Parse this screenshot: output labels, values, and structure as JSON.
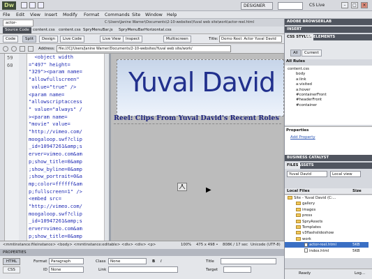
{
  "app": {
    "logo": "Dw",
    "workspace": "DESIGNER",
    "cs_live": "CS Live"
  },
  "menu": [
    "File",
    "Edit",
    "View",
    "Insert",
    "Modify",
    "Format",
    "Commands",
    "Site",
    "Window",
    "Help"
  ],
  "document": {
    "tab": "actor-reel.html",
    "path": "C:\\Users\\Janine Warner\\Documents\\2-10-websites\\Yuval web site\\work\\actor-reel.html",
    "related_files": [
      "Source Code",
      "content.css",
      "content.css",
      "SpryMenuBar.js",
      "SpryMenuBarHorizontal.css"
    ]
  },
  "toolbar": {
    "buttons": [
      "Code",
      "Split",
      "Design",
      "Live Code",
      "Live View",
      "Inspect",
      "Multiscreen"
    ],
    "title_label": "Title:",
    "title_value": "Demo Reel: Actor Yuval David"
  },
  "address": {
    "label": "Address:",
    "value": "file:///C|/Users/Janine Warner/Documents/2-10-websites/Yuval web site/work/"
  },
  "code": {
    "line_numbers": [
      "59",
      "60"
    ],
    "lines": [
      "  <object width",
      "=\"497\" height=",
      "\"329\"><param name=",
      "\"allowfullscreen\"",
      " value=\"true\" />",
      "<param name=",
      "\"allowscriptaccess",
      "\" value=\"always\" /",
      "><param name=",
      "\"movie\" value=",
      "\"http://vimeo.com/",
      "moogaloop.swf?clip",
      "_id=10947261&amp;s",
      "erver=vimeo.com&am",
      "p;show_title=0&amp",
      ";show_byline=0&amp",
      ";show_portrait=0&a",
      "mp;color=ffffff&am",
      "p;fullscreen=1\" />",
      "<embed src=",
      "\"http://vimeo.com/",
      "moogaloop.swf?clip",
      "_id=10947261&amp;s",
      "erver=vimeo.com&am",
      "p;show_title=0&amp"
    ]
  },
  "design": {
    "banner_title": "Yuval David",
    "heading": "Reel: Clips From Yuval David's Recent Roles"
  },
  "status": {
    "tags": "<mmtinstance:fileinstance> <body> <mmtinstance:editable> <div> <div> <p>",
    "zoom": "100%",
    "size": "475 x 498 •",
    "file_info": "808K / 17 sec",
    "encoding": "Unicode (UTF-8)"
  },
  "properties": {
    "header": "PROPERTIES",
    "html_btn": "HTML",
    "css_btn": "CSS",
    "format_label": "Format",
    "format_value": "Paragraph",
    "id_label": "ID",
    "id_value": "None",
    "class_label": "Class",
    "class_value": "None",
    "link_label": "Link",
    "title_label": "Title",
    "target_label": "Target",
    "bold": "B",
    "italic": "I"
  },
  "panels": {
    "adobe_browserlab": "ADOBE BROWSERLAB",
    "insert": "INSERT",
    "css_styles_tab": "CSS STYLES",
    "ap_elements_tab": "AP ELEMENTS",
    "all_btn": "All",
    "current_btn": "Current",
    "all_rules": "All Rules",
    "rules": [
      "content.css",
      "body",
      "a:link",
      "a:visited",
      "a:hover",
      "#containerFront",
      "#headerFront",
      "#container"
    ],
    "properties_label": "Properties",
    "add_property": "Add Property",
    "business_catalyst": "BUSINESS CATALYST",
    "files_tab": "FILES",
    "assets_tab": "ASSETS",
    "site_select": "Yuval David",
    "view_select": "Local view",
    "local_files": "Local Files",
    "size_col": "Size",
    "files": [
      {
        "name": "Site - Yuval David (C:...",
        "type": "site",
        "size": ""
      },
      {
        "name": "gallery",
        "type": "folder",
        "size": ""
      },
      {
        "name": "images",
        "type": "folder",
        "size": ""
      },
      {
        "name": "press",
        "type": "folder",
        "size": ""
      },
      {
        "name": "SpryAssets",
        "type": "folder",
        "size": ""
      },
      {
        "name": "Templates",
        "type": "folder",
        "size": ""
      },
      {
        "name": "v3flashslideshow",
        "type": "folder",
        "size": ""
      },
      {
        "name": "work",
        "type": "folder",
        "size": ""
      },
      {
        "name": "actor-reel.html",
        "type": "file",
        "size": "5KB"
      },
      {
        "name": "index.html",
        "type": "file",
        "size": "5KB"
      }
    ],
    "ready": "Ready",
    "log": "Log..."
  }
}
